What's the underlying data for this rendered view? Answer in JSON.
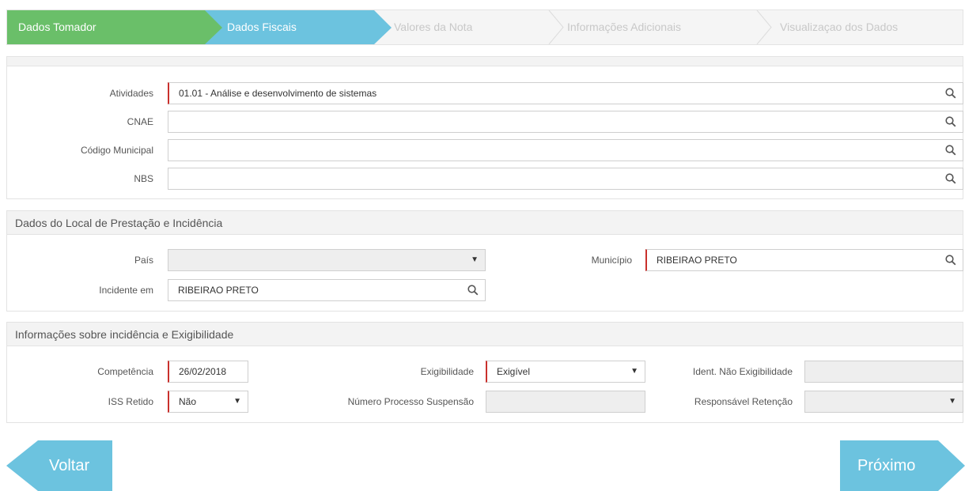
{
  "wizard": {
    "steps": [
      {
        "label": "Dados Tomador",
        "state": "done"
      },
      {
        "label": "Dados Fiscais",
        "state": "active"
      },
      {
        "label": "Valores da Nota",
        "state": "pending"
      },
      {
        "label": "Informações Adicionais",
        "state": "pending"
      },
      {
        "label": "Visualizaçao dos Dados",
        "state": "pending"
      }
    ]
  },
  "activity": {
    "atividades_label": "Atividades",
    "atividades_value": "01.01 - Análise e desenvolvimento de sistemas",
    "cnae_label": "CNAE",
    "cnae_value": "",
    "codigo_label": "Código Municipal",
    "codigo_value": "",
    "nbs_label": "NBS",
    "nbs_value": ""
  },
  "local": {
    "title": "Dados do Local de Prestação e Incidência",
    "pais_label": "País",
    "pais_value": "",
    "municipio_label": "Município",
    "municipio_value": "RIBEIRAO PRETO",
    "incidente_label": "Incidente em",
    "incidente_value": "RIBEIRAO PRETO"
  },
  "exigibilidade": {
    "title": "Informações sobre incidência e Exigibilidade",
    "competencia_label": "Competência",
    "competencia_value": "26/02/2018",
    "exigibilidade_label": "Exigibilidade",
    "exigibilidade_value": "Exigível",
    "ident_label": "Ident. Não Exigibilidade",
    "ident_value": "",
    "iss_label": "ISS Retido",
    "iss_value": "Não",
    "processo_label": "Número Processo Suspensão",
    "processo_value": "",
    "responsavel_label": "Responsável Retenção",
    "responsavel_value": ""
  },
  "nav": {
    "back_label": "Voltar",
    "next_label": "Próximo"
  },
  "colors": {
    "step_done": "#6abf69",
    "step_active": "#6cc3df",
    "required_marker": "#c9302c",
    "nav_button": "#6cc3df"
  }
}
